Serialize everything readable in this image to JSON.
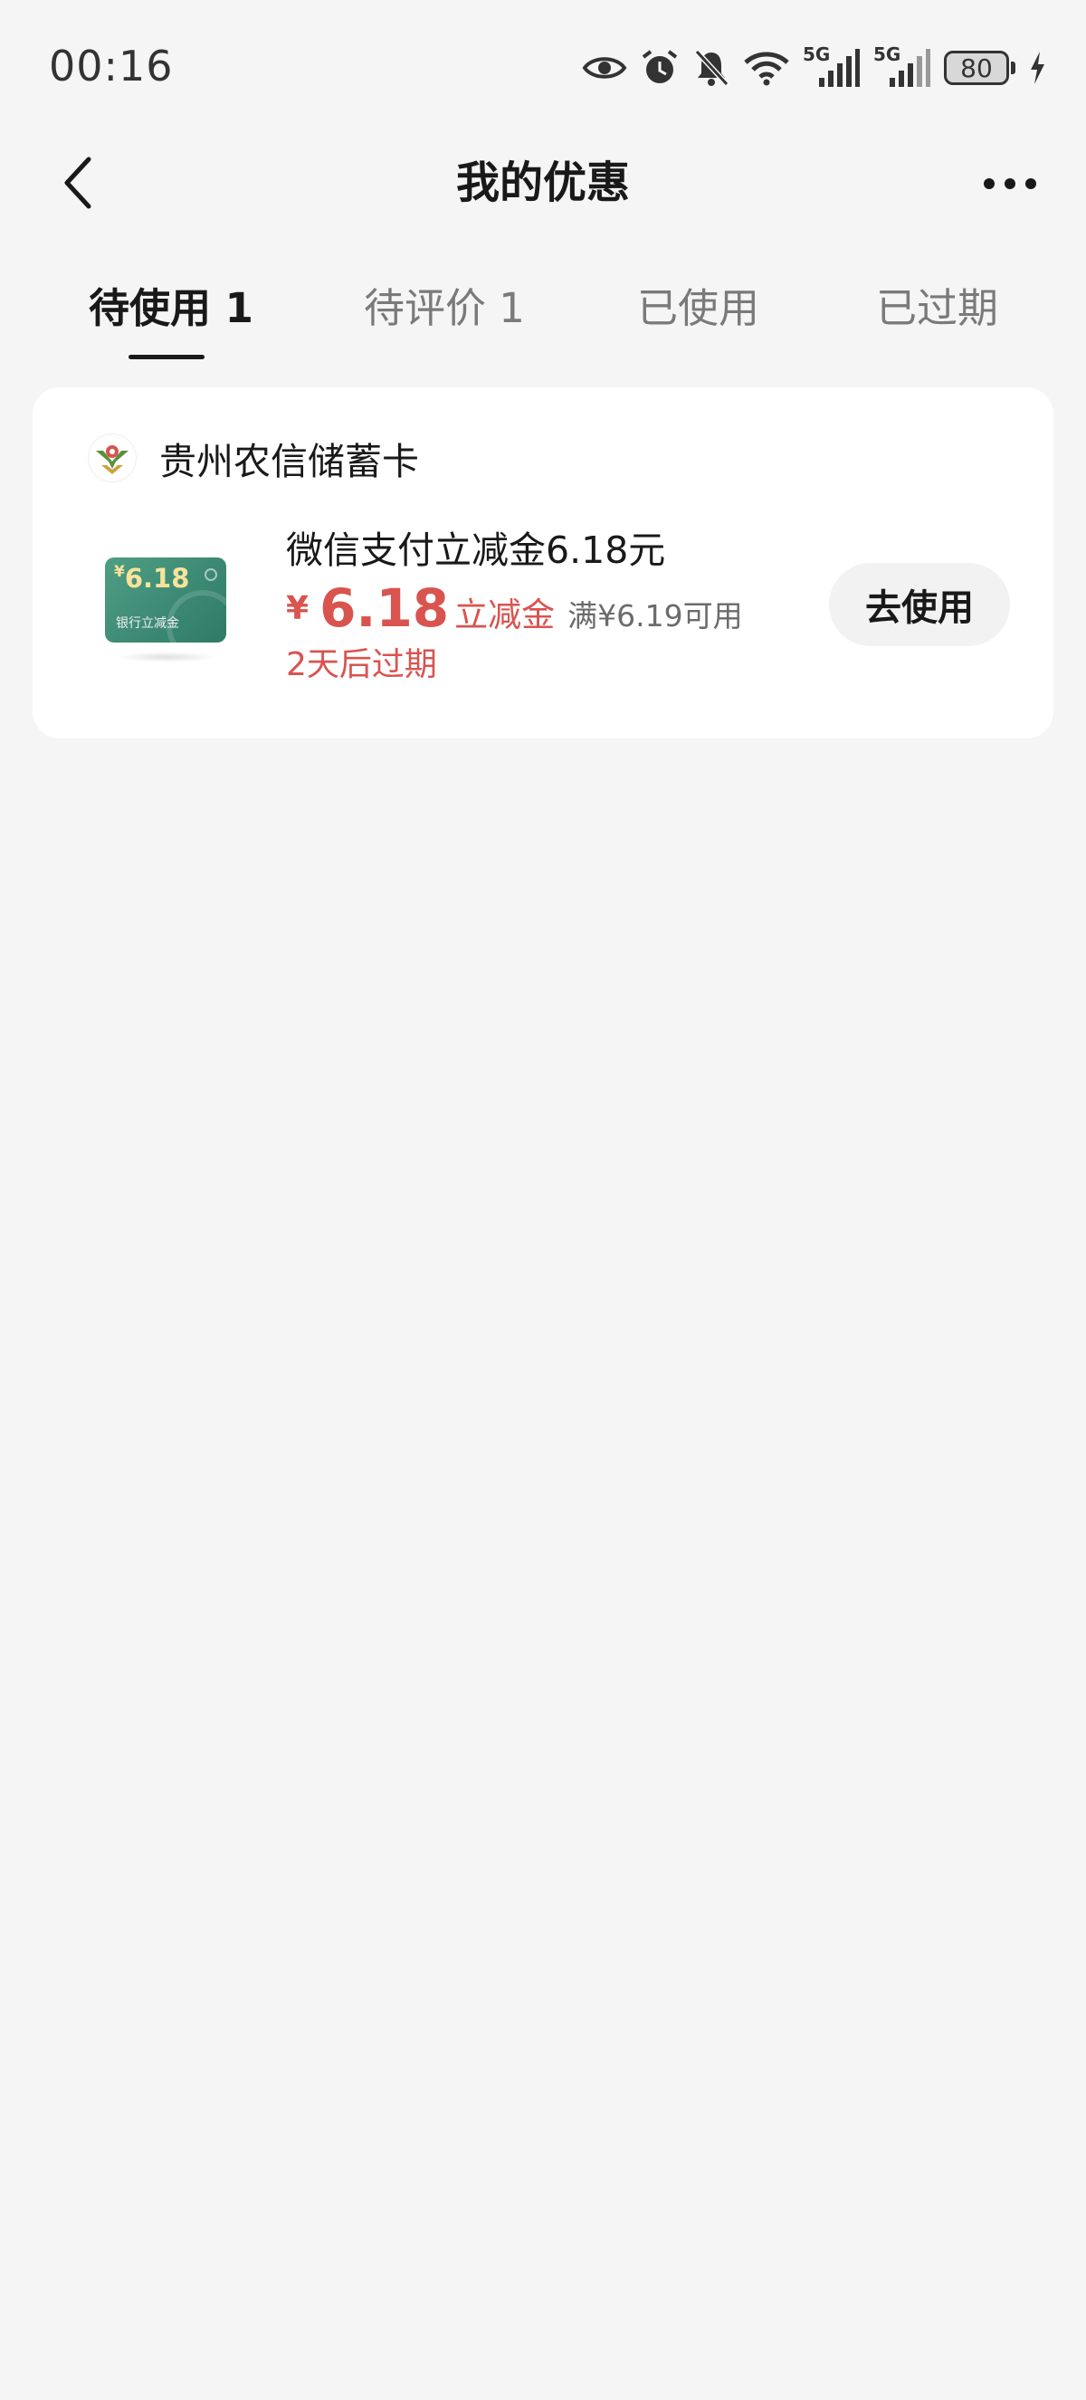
{
  "status_bar": {
    "time": "00:16",
    "network_1": "5G",
    "network_2": "5G",
    "battery": "80",
    "icons": [
      "eye-icon",
      "alarm-clock-icon",
      "notifications-off-icon",
      "wifi-icon",
      "signal-icon",
      "signal-icon",
      "battery-icon",
      "charging-icon"
    ]
  },
  "header": {
    "title": "我的优惠",
    "back_icon": "chevron-left-icon",
    "more_icon": "more-horizontal-icon"
  },
  "tabs": [
    {
      "label": "待使用 1",
      "active": true
    },
    {
      "label": "待评价 1",
      "active": false
    },
    {
      "label": "已使用",
      "active": false
    },
    {
      "label": "已过期",
      "active": false
    }
  ],
  "coupon": {
    "bank_name": "贵州农信储蓄卡",
    "thumb_amount": "6.18",
    "thumb_currency": "¥",
    "thumb_subtitle": "银行立减金",
    "title": "微信支付立减金6.18元",
    "currency": "¥",
    "amount": "6.18",
    "kind": "立减金",
    "condition": "满¥6.19可用",
    "expiry": "2天后过期",
    "action_label": "去使用"
  },
  "colors": {
    "accent_red": "#d9534f",
    "thumb_green": "#3d8a73",
    "background": "#f5f5f5"
  }
}
